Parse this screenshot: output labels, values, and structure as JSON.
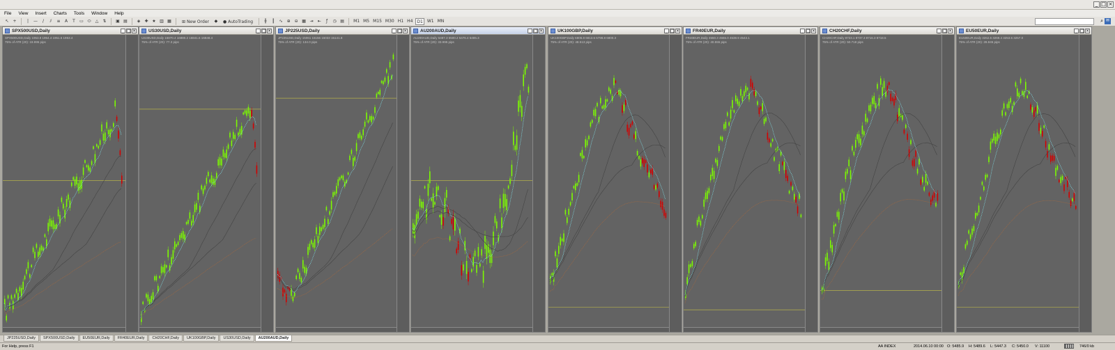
{
  "window": {
    "minimize_icon": "minimize-icon",
    "restore_icon": "restore-icon",
    "close_icon": "close-icon"
  },
  "menu": [
    "File",
    "View",
    "Insert",
    "Charts",
    "Tools",
    "Window",
    "Help"
  ],
  "toolbar": {
    "new_order_label": "New Order",
    "autotrading_label": "AutoTrading",
    "timeframes": [
      "M1",
      "M5",
      "M15",
      "M30",
      "H1",
      "H4",
      "D1",
      "W1",
      "MN"
    ],
    "active_timeframe": "D1"
  },
  "charts": [
    {
      "title": "SPX500USD,Daily",
      "info1": "SPX500USD,Daily 1953.8 1954.4 1951.6 1953.4",
      "info2": "75% of ATR (20): 19.995 pips"
    },
    {
      "title": "US30USD,Daily",
      "info1": "US30USD,Daily 16870.4 16880.2 16841.6 16848.4",
      "info2": "75% of ATR (20): 77.3 pips"
    },
    {
      "title": "JP225USD,Daily",
      "info1": "JP225USD,Daily 15061 15156 15033 15141.8",
      "info2": "75% of ATR (20): 134.0 pips"
    },
    {
      "title": "AU200AUD,Daily",
      "info1": "AU200AUD,Daily 5487.3 5500.2 5476.4 5485.3",
      "info2": "75% of ATR (20): 33.995 pips"
    },
    {
      "title": "UK100GBP,Daily",
      "info1": "UK100GBP,Daily 6806.8 6813.6 6798.8 6800.3",
      "info2": "75% of ATR (20): 48.513 pips"
    },
    {
      "title": "FR40EUR,Daily",
      "info1": "FR40EUR,Daily 4550.3 4555.0 4538.9 4543.1",
      "info2": "75% of ATR (20): 40.555 pips"
    },
    {
      "title": "CH20CHF,Daily",
      "info1": "CH20CHF,Daily 8723.1 8737.3 8716.3 8718.5",
      "info2": "75% of ATR (20): 50.718 pips"
    },
    {
      "title": "EU50EUR,Daily",
      "info1": "EU50EUR,Daily 3262.6 3269.4 3253.6 3257.0",
      "info2": "75% of ATR (20): 28.845 pips"
    }
  ],
  "tabs": [
    "JP225USD,Daily",
    "SPX500USD,Daily",
    "EU50EUR,Daily",
    "FR40EUR,Daily",
    "CH20CHF,Daily",
    "UK100GBP,Daily",
    "US30USD,Daily",
    "AU200AUD,Daily"
  ],
  "active_tab": "AU200AUD,Daily",
  "status": {
    "help": "For Help, press F1",
    "profile": "AA INDEX",
    "datetime": "2014.06.10 00:00",
    "open": "O: 5485.9",
    "high": "H: 5489.6",
    "low": "L: 5447.3",
    "close": "C: 5450.0",
    "volume": "V: 11100",
    "traffic": "746/0 kb"
  },
  "colors": {
    "chart_bg": "#636363",
    "bull": "#7cfc00",
    "bear": "#d40000",
    "ma_fast": "#7fdde6",
    "ma_slow": "#444444",
    "ma_long": "#b06a3a",
    "level": "#b6b24a"
  }
}
